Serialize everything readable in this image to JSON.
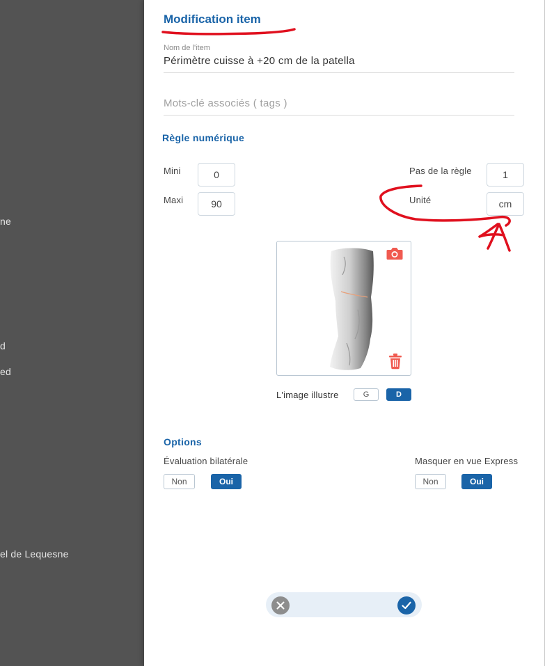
{
  "background": {
    "fragments": [
      "ne",
      "d",
      "ed",
      "el de Lequesne"
    ]
  },
  "modal": {
    "title": "Modification item",
    "item_name": {
      "label": "Nom de l'item",
      "value": "Périmètre cuisse à +20 cm de la patella"
    },
    "tags": {
      "placeholder": "Mots-clé associés ( tags )"
    },
    "numeric_rule": {
      "section_title": "Règle numérique",
      "mini_label": "Mini",
      "mini_value": "0",
      "maxi_label": "Maxi",
      "maxi_value": "90",
      "step_label": "Pas de la règle",
      "step_value": "1",
      "unit_label": "Unité",
      "unit_value": "cm"
    },
    "illustration": {
      "label": "L'image illustre",
      "left_label": "G",
      "right_label": "D",
      "selected": "D",
      "camera_icon": "camera-icon",
      "trash_icon": "trash-icon"
    },
    "options": {
      "section_title": "Options",
      "bilateral": {
        "label": "Évaluation bilatérale",
        "no_label": "Non",
        "yes_label": "Oui",
        "selected": "Oui"
      },
      "express": {
        "label": "Masquer en vue Express",
        "no_label": "Non",
        "yes_label": "Oui",
        "selected": "Oui"
      }
    },
    "actions": {
      "cancel_icon": "close-icon",
      "confirm_icon": "check-icon"
    }
  },
  "colors": {
    "accent": "#1a64a8",
    "annotation": "#e0101e",
    "icon_red": "#f05a50",
    "backdrop": "#535353"
  }
}
